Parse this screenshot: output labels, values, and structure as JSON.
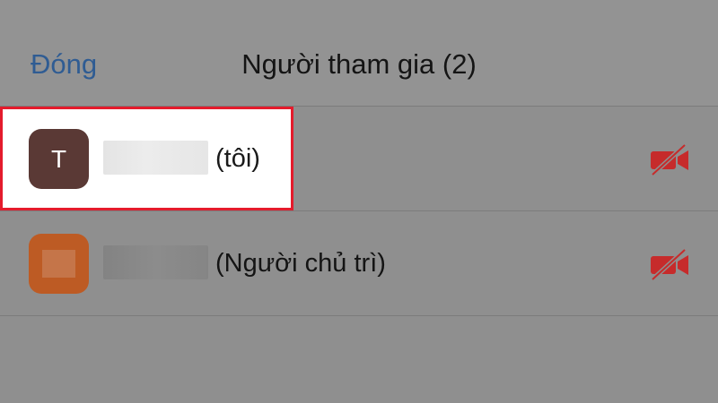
{
  "header": {
    "close_label": "Đóng",
    "title": "Người tham gia (2)"
  },
  "participants": [
    {
      "avatar_letter": "T",
      "avatar_color": "#5a3935",
      "name_suffix": "(tôi)",
      "video_icon": "video-off-icon",
      "highlighted": true
    },
    {
      "avatar_color": "#bd5b24",
      "name_suffix": "(Người chủ trì)",
      "video_icon": "video-off-icon",
      "highlighted": false
    }
  ],
  "colors": {
    "accent_link": "#2f5c93",
    "highlight_border": "#e41b2c",
    "video_off": "#c62b2b"
  }
}
